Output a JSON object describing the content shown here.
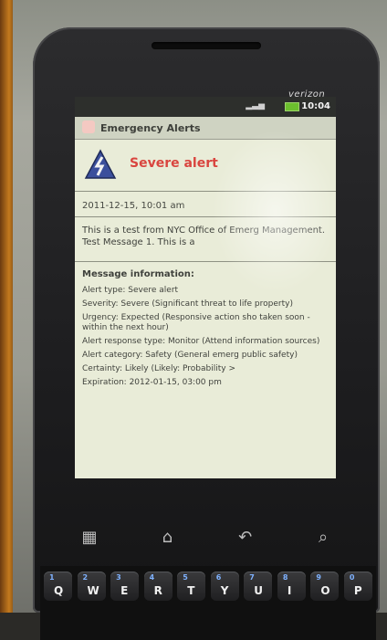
{
  "device": {
    "carrier": "verizon",
    "clock": "10:04",
    "app_title": "Emergency Alerts"
  },
  "alert": {
    "title": "Severe alert",
    "timestamp": "2011-12-15, 10:01 am",
    "message": "This is a test from NYC Office of Emerg Management. Test Message 1. This is a"
  },
  "info": {
    "heading": "Message information:",
    "rows": [
      "Alert type: Severe alert",
      "Severity: Severe (Significant threat to life property)",
      "Urgency: Expected (Responsive action sho taken soon - within the next hour)",
      "Alert response type: Monitor (Attend information sources)",
      "Alert category: Safety (General emerg public safety)",
      "Certainty: Likely (Likely: Probability >",
      "Expiration: 2012-01-15, 03:00 pm"
    ]
  },
  "softkeys": [
    "▦",
    "⌂",
    "↶",
    "⌕"
  ],
  "keyboard": [
    {
      "alt": "1",
      "main": "Q"
    },
    {
      "alt": "2",
      "main": "W"
    },
    {
      "alt": "3",
      "main": "E"
    },
    {
      "alt": "4",
      "main": "R"
    },
    {
      "alt": "5",
      "main": "T"
    },
    {
      "alt": "6",
      "main": "Y"
    },
    {
      "alt": "7",
      "main": "U"
    },
    {
      "alt": "8",
      "main": "I"
    },
    {
      "alt": "9",
      "main": "O"
    },
    {
      "alt": "0",
      "main": "P"
    }
  ],
  "icons": {
    "warning": "warning-triangle-icon"
  },
  "colors": {
    "alert_red": "#d9453f",
    "screen_bg": "#e9ecd8",
    "battery_green": "#6cbf2e"
  }
}
